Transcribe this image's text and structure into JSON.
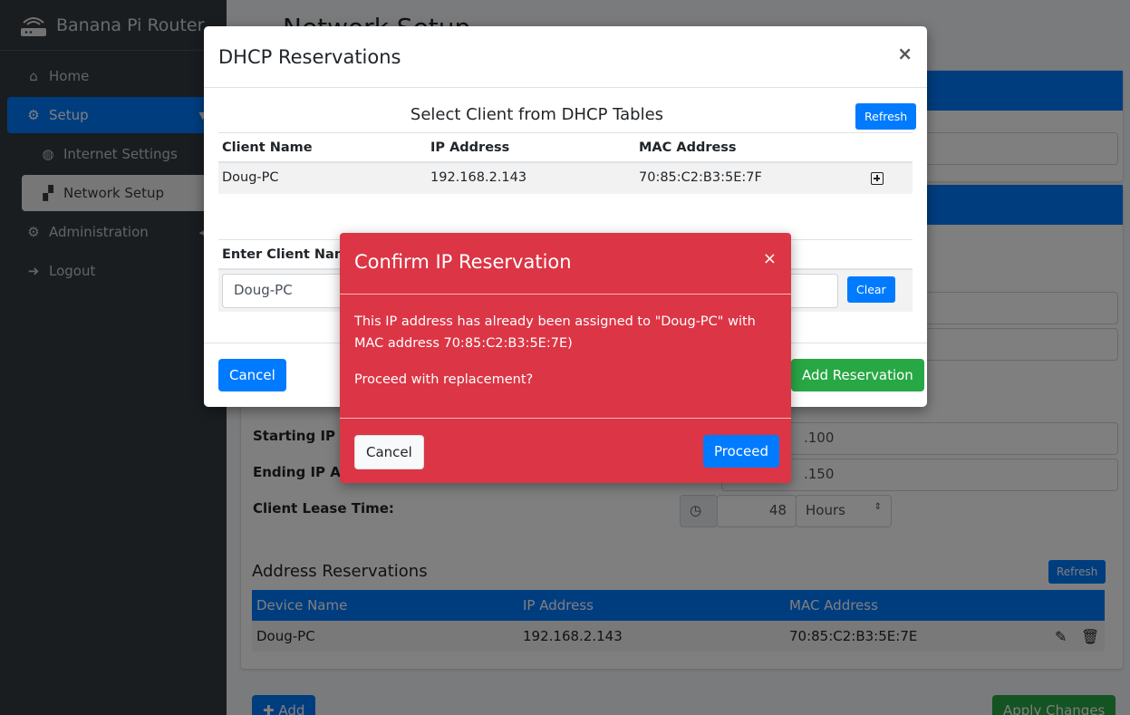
{
  "app": {
    "brand": "Banana Pi Router"
  },
  "sidebar": {
    "items": [
      {
        "label": "Home",
        "icon": "home-icon"
      },
      {
        "label": "Setup",
        "icon": "gear-icon"
      },
      {
        "label": "Internet Settings",
        "icon": "globe-icon"
      },
      {
        "label": "Network Setup",
        "icon": "network-icon"
      },
      {
        "label": "Administration",
        "icon": "gear-icon"
      },
      {
        "label": "Logout",
        "icon": "logout-icon"
      }
    ]
  },
  "background": {
    "page_title": "Network Setup",
    "starting_ip_label": "Starting IP Address:",
    "ending_ip_label": "Ending IP Address:",
    "lease_label": "Client Lease Time:",
    "starting_ip_value": ".100",
    "ending_ip_value": ".150",
    "lease_value": "48",
    "lease_unit": "Hours",
    "reservations_title": "Address Reservations",
    "refresh": "Refresh",
    "columns": [
      "Device Name",
      "IP Address",
      "MAC Address"
    ],
    "row": {
      "name": "Doug-PC",
      "ip": "192.168.2.143",
      "mac": "70:85:C2:B3:5E:7E"
    },
    "add_label": "Add",
    "apply_label": "Apply Changes"
  },
  "dhcp_modal": {
    "title": "DHCP Reservations",
    "close": "×",
    "section_title": "Select Client from DHCP Tables",
    "refresh": "Refresh",
    "columns": [
      "Client Name",
      "IP Address",
      "MAC Address"
    ],
    "row": {
      "name": "Doug-PC",
      "ip": "192.168.2.143",
      "mac": "70:85:C2:B3:5E:7F"
    },
    "enter_label": "Enter Client Name",
    "client_value": "Doug-PC",
    "clear": "Clear",
    "cancel": "Cancel",
    "add": "Add Reservation"
  },
  "confirm_modal": {
    "title": "Confirm IP Reservation",
    "close": "×",
    "message": "This IP address has already been assigned to \"Doug-PC\" with MAC address 70:85:C2:B3:5E:7E)",
    "question": "Proceed with replacement?",
    "cancel": "Cancel",
    "proceed": "Proceed"
  },
  "colors": {
    "primary": "#007bff",
    "danger": "#dc3545",
    "success": "#28a745",
    "sidebar": "#343a40"
  }
}
